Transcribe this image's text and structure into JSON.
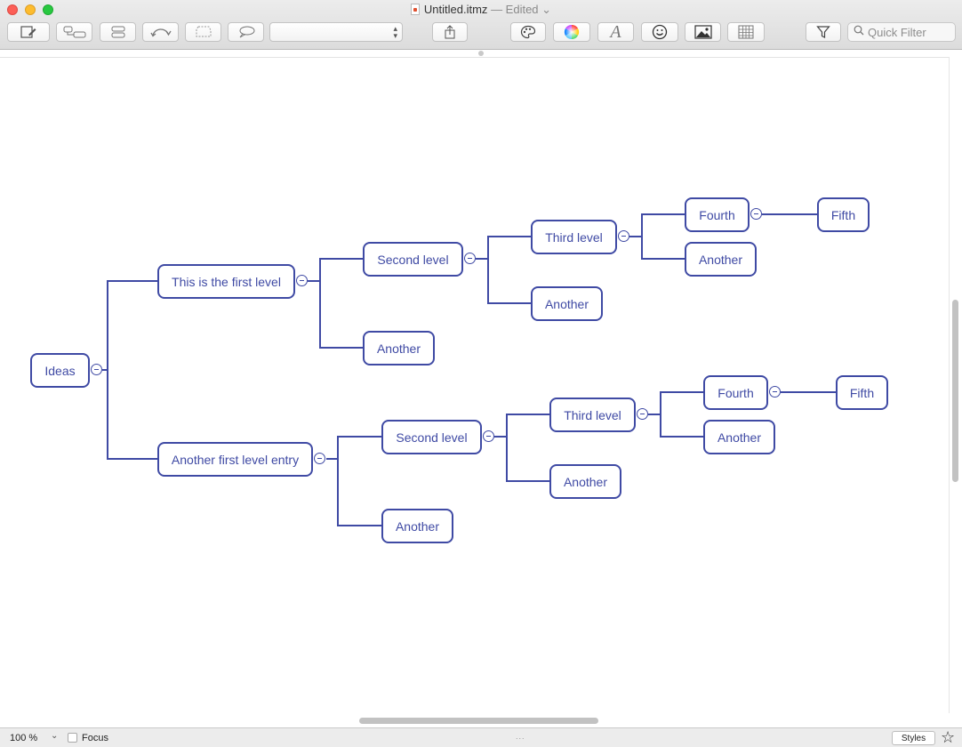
{
  "window": {
    "filename": "Untitled.itmz",
    "edited": "— Edited"
  },
  "toolbar": {
    "buttons": [
      {
        "name": "new-topic-icon"
      },
      {
        "name": "add-child-icon"
      },
      {
        "name": "add-sibling-icon"
      },
      {
        "name": "relationship-icon"
      },
      {
        "name": "boundary-icon"
      },
      {
        "name": "callout-icon"
      }
    ],
    "style_select_value": "",
    "format_buttons": [
      {
        "name": "palette-icon"
      },
      {
        "name": "color-wheel-icon"
      },
      {
        "name": "font-icon"
      },
      {
        "name": "emoji-icon"
      },
      {
        "name": "image-icon"
      },
      {
        "name": "table-icon"
      }
    ],
    "quick_filter_placeholder": "Quick Filter"
  },
  "map": {
    "root": "Ideas",
    "nodes": {
      "n1": "This is the first level",
      "n2": "Second level",
      "n3": "Third level",
      "n4": "Fourth",
      "n5": "Fifth",
      "n6": "Another",
      "n7": "Another",
      "n8": "Another",
      "m1": "Another first level entry",
      "m2": "Second level",
      "m3": "Third level",
      "m4": "Fourth",
      "m5": "Fifth",
      "m6": "Another",
      "m7": "Another",
      "m8": "Another"
    },
    "line_color": "#3f4aa4"
  },
  "status": {
    "zoom": "100 %",
    "focus_label": "Focus",
    "focus_checked": false,
    "middle": "...",
    "styles_label": "Styles"
  }
}
